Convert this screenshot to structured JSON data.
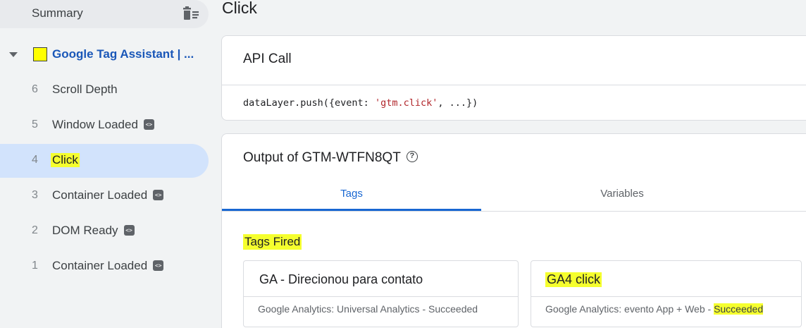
{
  "sidebar": {
    "summary_label": "Summary",
    "container": {
      "name": "Google Tag Assistant | ...",
      "swatch_color": "#ffff00"
    },
    "events": [
      {
        "num": "6",
        "label": "Scroll Depth",
        "has_code_icon": false,
        "selected": false
      },
      {
        "num": "5",
        "label": "Window Loaded",
        "has_code_icon": true,
        "selected": false
      },
      {
        "num": "4",
        "label": "Click",
        "has_code_icon": false,
        "selected": true
      },
      {
        "num": "3",
        "label": "Container Loaded",
        "has_code_icon": true,
        "selected": false
      },
      {
        "num": "2",
        "label": "DOM Ready",
        "has_code_icon": true,
        "selected": false
      },
      {
        "num": "1",
        "label": "Container Loaded",
        "has_code_icon": true,
        "selected": false
      }
    ],
    "code_icon_glyph": "<>"
  },
  "main": {
    "title": "Click",
    "api_card": {
      "header": "API Call",
      "code_prefix": "dataLayer.push({event: ",
      "code_string": "'gtm.click'",
      "code_suffix": ", ...})"
    },
    "output_card": {
      "header": "Output of GTM-WTFN8QT",
      "help_glyph": "?",
      "tabs": [
        {
          "label": "Tags",
          "active": true
        },
        {
          "label": "Variables",
          "active": false
        }
      ],
      "section_title": "Tags Fired",
      "tags": [
        {
          "name": "GA - Direcionou para contato",
          "sub_prefix": "Google Analytics: Universal Analytics - ",
          "status": "Succeeded"
        },
        {
          "name": "GA4 click",
          "sub_prefix": "Google Analytics: evento App + Web - ",
          "status": "Succeeded"
        }
      ]
    }
  },
  "colors": {
    "highlight": "#f5ff2e",
    "accent_blue": "#1967d2",
    "selected_bg": "#d2e3fc"
  }
}
